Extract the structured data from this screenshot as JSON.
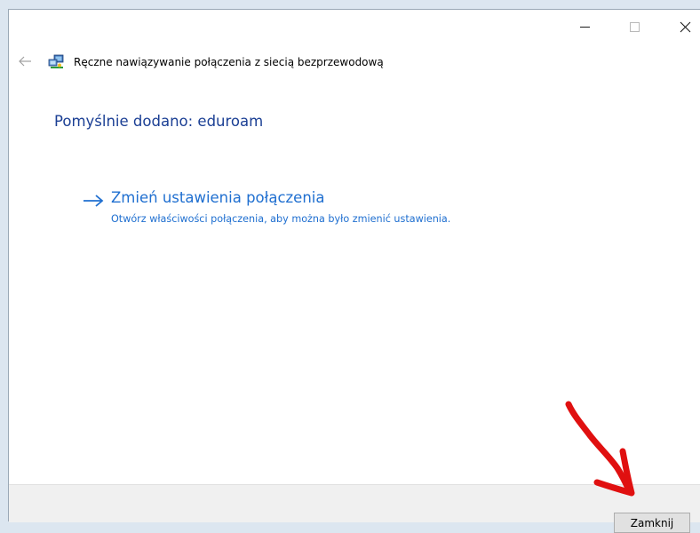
{
  "window": {
    "nav_title": "Ręczne nawiązywanie połączenia z siecią bezprzewodową",
    "controls": {
      "minimize": "minimize-icon",
      "maximize": "maximize-icon",
      "close": "close-icon"
    }
  },
  "main": {
    "success_text": "Pomyślnie dodano: eduroam",
    "link": {
      "title": "Zmień ustawienia połączenia",
      "description": "Otwórz właściwości połączenia, aby można było zmienić ustawienia."
    }
  },
  "footer": {
    "close_label": "Zamknij"
  },
  "colors": {
    "heading": "#1b3f94",
    "link": "#1f6fd0",
    "annotation": "#e01010"
  }
}
